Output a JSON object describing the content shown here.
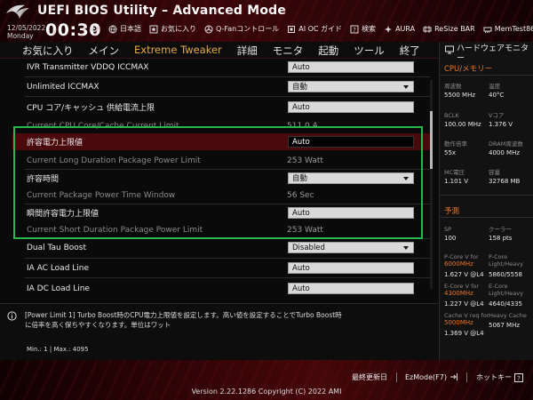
{
  "header": {
    "title": "UEFI BIOS Utility – Advanced Mode",
    "date": "12/05/2022",
    "weekday": "Monday",
    "time": "00:30",
    "toolbar": [
      {
        "label": "日本語",
        "icon": "globe-icon"
      },
      {
        "label": "お気に入り",
        "icon": "star-icon"
      },
      {
        "label": "Q-Fanコントロール",
        "icon": "fan-icon"
      },
      {
        "label": "AI OC ガイド",
        "icon": "ai-icon"
      },
      {
        "label": "検索",
        "icon": "question-icon"
      },
      {
        "label": "AURA",
        "icon": "aura-icon"
      },
      {
        "label": "ReSize BAR",
        "icon": "resizebar-icon"
      },
      {
        "label": "MemTest86",
        "icon": "memtest-icon"
      }
    ]
  },
  "tabs": [
    "お気に入り",
    "メイン",
    "Extreme Tweaker",
    "詳細",
    "モニタ",
    "起動",
    "ツール",
    "終了"
  ],
  "active_tab": "Extreme Tweaker",
  "settings": [
    {
      "label": "IVR Transmitter VDDQ ICCMAX",
      "value": "Auto",
      "kind": "field"
    },
    {
      "label": "Unlimited ICCMAX",
      "value": "自動",
      "kind": "dropdown"
    },
    {
      "label": "CPU コア/キャッシュ 供給電流上限",
      "value": "Auto",
      "kind": "field"
    },
    {
      "label": "Current CPU Core/Cache Current Limit",
      "value": "511.0 A",
      "kind": "readonly"
    },
    {
      "label": "許容電力上限値",
      "value": "Auto",
      "kind": "field-selected"
    },
    {
      "label": "Current Long Duration Package Power Limit",
      "value": "253 Watt",
      "kind": "readonly"
    },
    {
      "label": "許容時間",
      "value": "自動",
      "kind": "dropdown"
    },
    {
      "label": "Current Package Power Time Window",
      "value": "56 Sec",
      "kind": "readonly"
    },
    {
      "label": "瞬間許容電力上限値",
      "value": "Auto",
      "kind": "field"
    },
    {
      "label": "Current Short Duration Package Power Limit",
      "value": "253 Watt",
      "kind": "readonly"
    },
    {
      "label": "Dual Tau Boost",
      "value": "Disabled",
      "kind": "dropdown"
    },
    {
      "label": "IA AC Load Line",
      "value": "Auto",
      "kind": "field"
    },
    {
      "label": "IA DC Load Line",
      "value": "Auto",
      "kind": "field"
    }
  ],
  "help": {
    "text": "[Power Limit 1] Turbo Boost時のCPU電力上限値を設定します。高い値を設定することでTurbo Boost時に倍率を高く保ちやすくなります。単位はワット",
    "minmax": "Min.: 1   |   Max.: 4095"
  },
  "monitor": {
    "title": "ハードウェアモニター",
    "cpu_section": "CPU/メモリー",
    "cpu": [
      {
        "label": "周波数",
        "value": "5500 MHz"
      },
      {
        "label": "温度",
        "value": "40°C"
      },
      {
        "label": "BCLK",
        "value": "100.00 MHz"
      },
      {
        "label": "Vコア",
        "value": "1.376 V"
      },
      {
        "label": "動作倍率",
        "value": "55x"
      },
      {
        "label": "DRAM周波数",
        "value": "4000 MHz"
      },
      {
        "label": "MC電圧",
        "value": "1.101 V"
      },
      {
        "label": "容量",
        "value": "32768 MB"
      }
    ],
    "predict_section": "予測",
    "predict": [
      {
        "label": "SP",
        "value": "100"
      },
      {
        "label": "クーラー",
        "value": "158 pts"
      }
    ],
    "pcore_label": "P-Core V for",
    "pcore_freq": "6000MHz",
    "pcore_value": "1.627 V @L4",
    "pcore_light_label": "P-Core Light/Heavy",
    "pcore_light_value": "5860/5558",
    "ecore_label": "E-Core V for",
    "ecore_freq": "4300MHz",
    "ecore_value": "1.227 V @L4",
    "ecore_light_label": "E-Core Light/Heavy",
    "ecore_light_value": "4640/4335",
    "cache_label": "Cache V req for",
    "cache_freq": "5000MHz",
    "cache_value": "1.369 V @L4",
    "heavy_cache_label": "Heavy Cache",
    "heavy_cache_value": "5067 MHz"
  },
  "footer": {
    "last_modified": "最終更新日",
    "ezmode": "EzMode(F7)",
    "hotkeys": "ホットキー",
    "version": "Version 2.22.1286 Copyright (C) 2022 AMI"
  },
  "colors": {
    "accent": "#e8742a",
    "tab_active": "#e8a84a",
    "selection": "#4a0a0d",
    "highlight_box": "#27b84a"
  }
}
